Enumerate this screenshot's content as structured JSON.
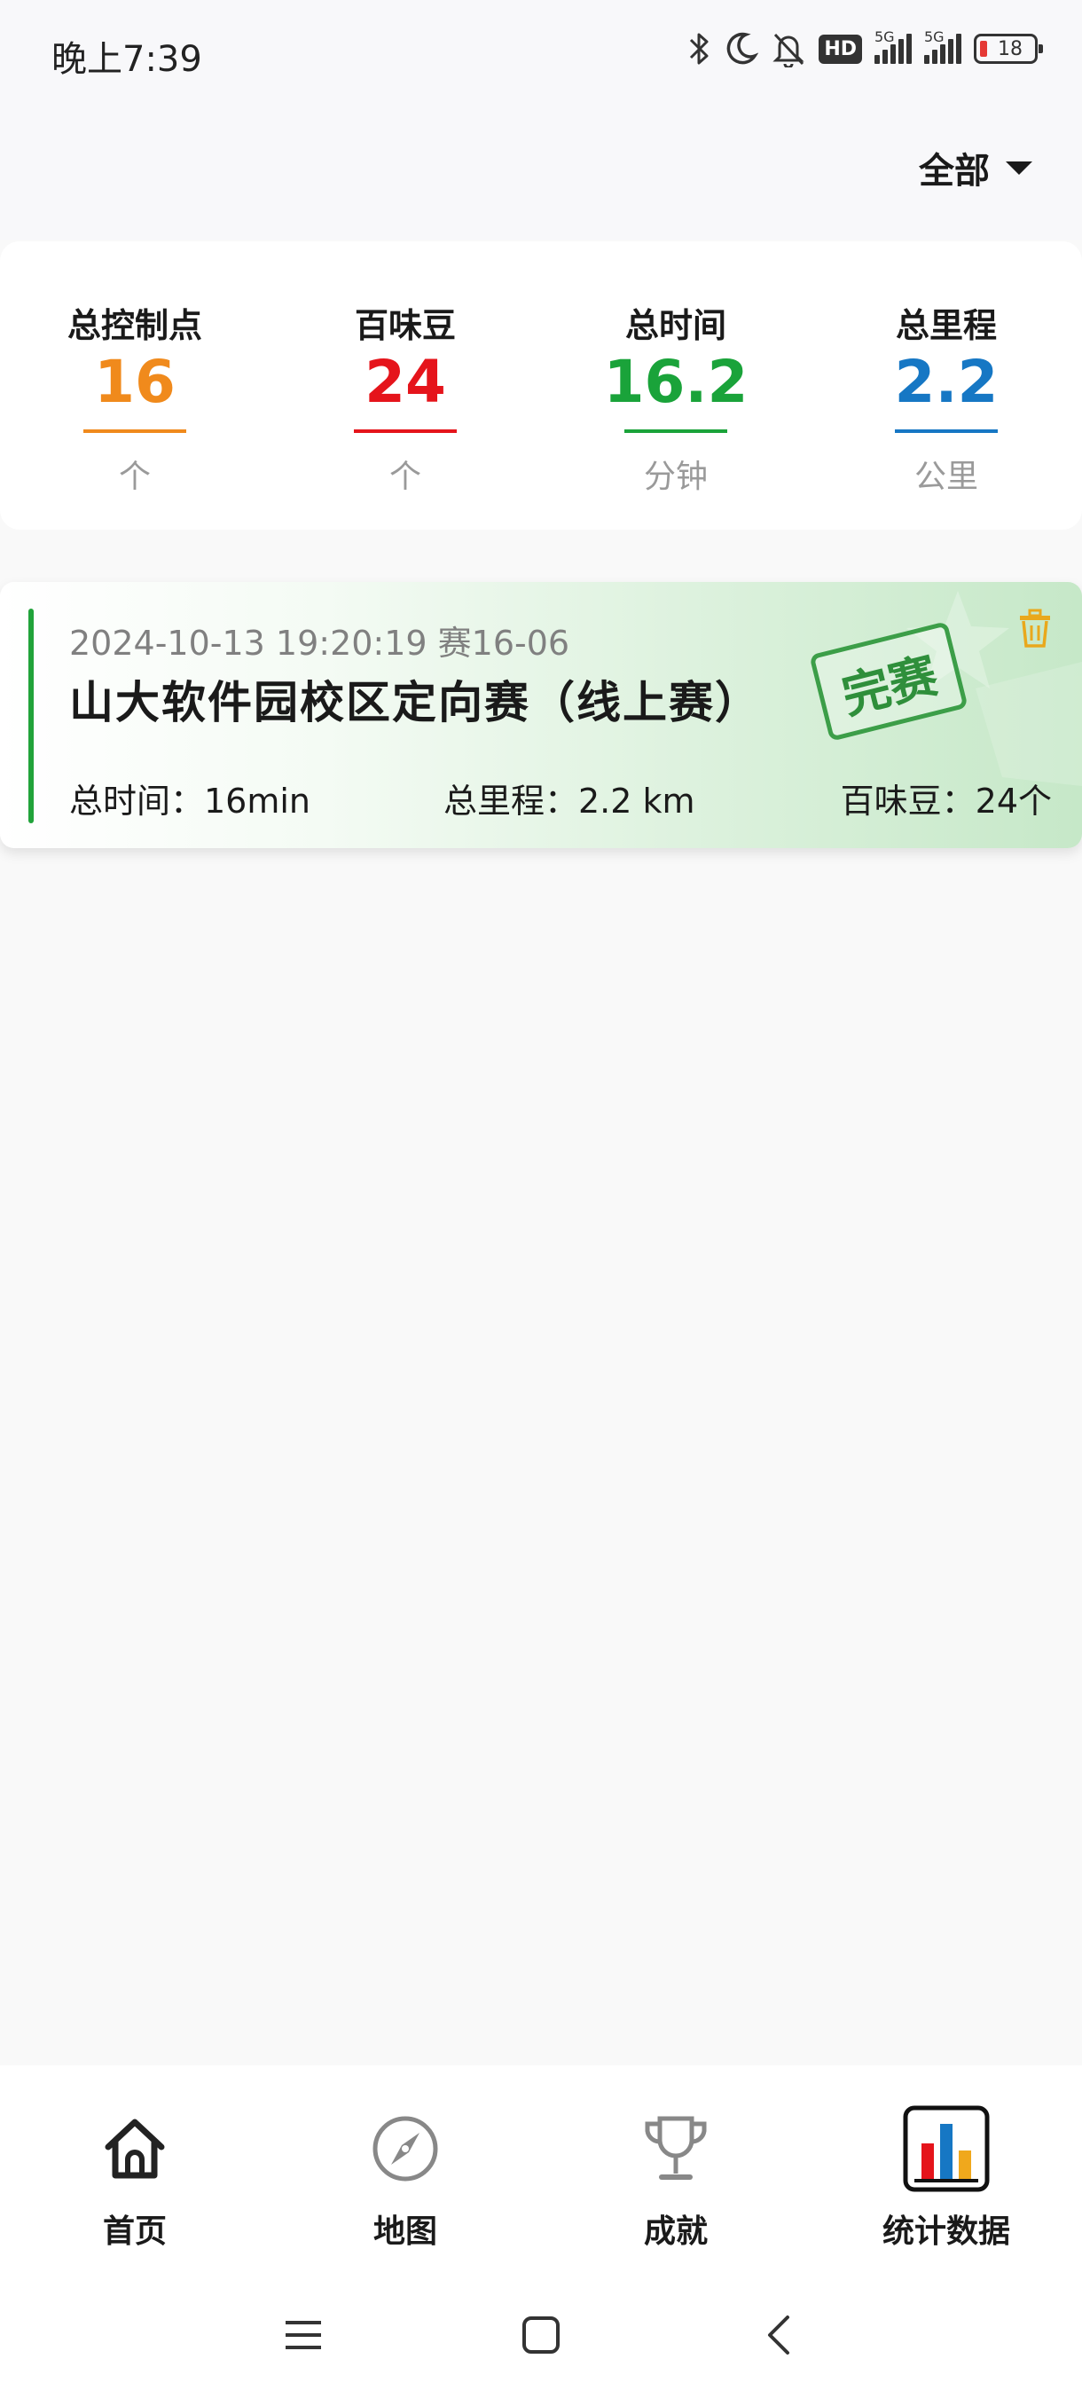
{
  "status_bar": {
    "time": "晚上7:39",
    "hd": "HD",
    "net1": "5G",
    "net2": "5G",
    "battery": "18"
  },
  "header": {
    "filter_label": "全部"
  },
  "summary": {
    "items": [
      {
        "label": "总控制点",
        "value": "16",
        "unit": "个",
        "color": "#f08a1c"
      },
      {
        "label": "百味豆",
        "value": "24",
        "unit": "个",
        "color": "#e5141b"
      },
      {
        "label": "总时间",
        "value": "16.2",
        "unit": "分钟",
        "color": "#1aa33a"
      },
      {
        "label": "总里程",
        "value": "2.2",
        "unit": "公里",
        "color": "#1677c4"
      }
    ]
  },
  "records": [
    {
      "meta": "2024-10-13 19:20:19 赛16-06",
      "title": "山大软件园校区定向赛（线上赛）",
      "stamp": "完赛",
      "total_time": "总时间：16min",
      "total_distance": "总里程：2.2 km",
      "beans": "百味豆：24个"
    }
  ],
  "bottom_nav": {
    "items": [
      {
        "label": "首页",
        "icon": "home-icon"
      },
      {
        "label": "地图",
        "icon": "compass-icon"
      },
      {
        "label": "成就",
        "icon": "trophy-icon"
      },
      {
        "label": "统计数据",
        "icon": "stats-icon"
      }
    ]
  }
}
